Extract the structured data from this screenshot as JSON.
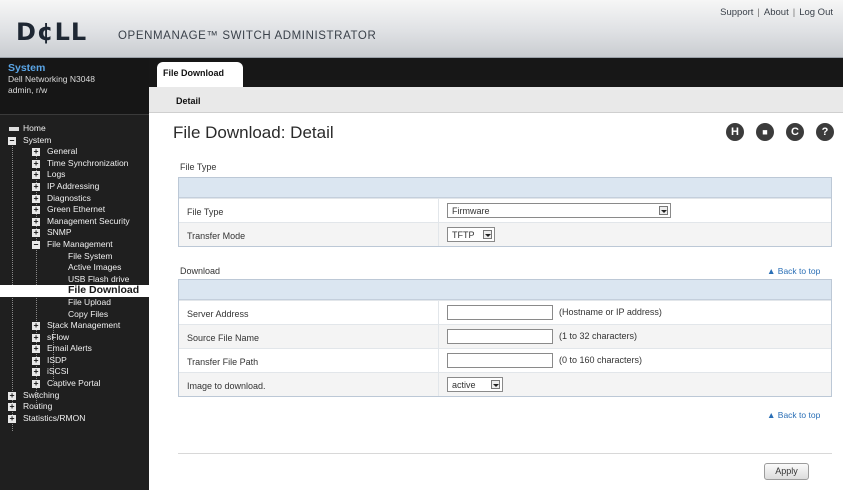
{
  "header": {
    "logo": "D¢LL",
    "title": "OPENMANAGE™ SWITCH ADMINISTRATOR",
    "links": [
      "Support",
      "About",
      "Log Out"
    ]
  },
  "system_info": {
    "title": "System",
    "model": "Dell Networking N3048",
    "user": "admin, r/w"
  },
  "nav": {
    "home": "Home",
    "system": "System",
    "general": "General",
    "time_sync": "Time Synchronization",
    "logs": "Logs",
    "ip_addressing": "IP Addressing",
    "diagnostics": "Diagnostics",
    "green_ethernet": "Green Ethernet",
    "mgmt_security": "Management Security",
    "snmp": "SNMP",
    "file_management": "File Management",
    "file_system": "File System",
    "active_images": "Active Images",
    "usb_flash": "USB Flash drive",
    "file_download": "File Download",
    "file_upload": "File Upload",
    "copy_files": "Copy Files",
    "stack_mgmt": "Stack Management",
    "sflow": "sFlow",
    "email_alerts": "Email Alerts",
    "isdp": "ISDP",
    "iscsi": "iSCSI",
    "captive_portal": "Captive Portal",
    "switching": "Switching",
    "routing": "Routing",
    "statistics": "Statistics/RMON"
  },
  "tabs": {
    "main": "File Download",
    "sub": "Detail"
  },
  "page": {
    "title": "File Download: Detail",
    "tools": [
      "H",
      "■",
      "C",
      "?"
    ]
  },
  "file_type_section": {
    "label": "File Type",
    "rows": {
      "file_type": {
        "label": "File Type",
        "value": "Firmware"
      },
      "transfer_mode": {
        "label": "Transfer Mode",
        "value": "TFTP"
      }
    }
  },
  "download_section": {
    "label": "Download",
    "back_to_top": "▲ Back to top",
    "rows": {
      "server_address": {
        "label": "Server Address",
        "value": "",
        "hint": "(Hostname or IP address)"
      },
      "source_file": {
        "label": "Source File Name",
        "value": "",
        "hint": "(1 to 32 characters)"
      },
      "transfer_path": {
        "label": "Transfer File Path",
        "value": "",
        "hint": "(0 to 160 characters)"
      },
      "image": {
        "label": "Image to download.",
        "value": "active"
      }
    }
  },
  "back_to_top_bottom": "▲ Back to top",
  "apply_label": "Apply"
}
